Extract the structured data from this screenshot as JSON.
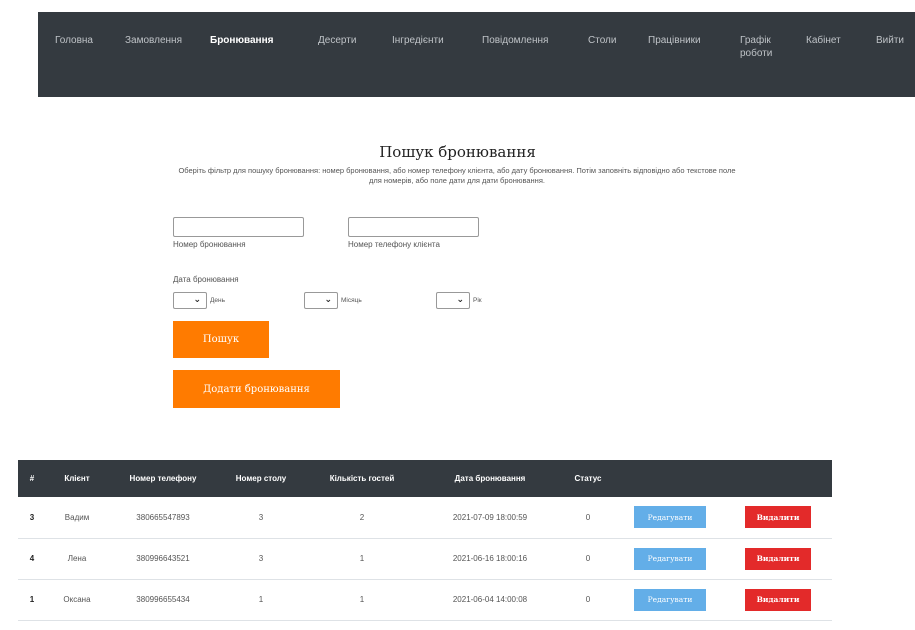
{
  "nav": {
    "items": [
      {
        "label": "Головна"
      },
      {
        "label": "Замовлення"
      },
      {
        "label": "Бронювання"
      },
      {
        "label": "Десерти"
      },
      {
        "label": "Інгредієнти"
      },
      {
        "label": "Повідомлення"
      },
      {
        "label": "Столи"
      },
      {
        "label": "Працівники"
      },
      {
        "label": "Графік роботи"
      },
      {
        "label": "Кабінет"
      },
      {
        "label": "Вийти"
      }
    ],
    "active": "Бронювання"
  },
  "search": {
    "title": "Пошук бронювання",
    "description": "Оберіть фільтр для пошуку бронювання: номер бронювання, або номер телефону клієнта, або дату бронювання. Потім заповніть відповідно або текстове поле для номерів, або поле дати для дати бронювання.",
    "booking_number_label": "Номер бронювання",
    "phone_label": "Номер телефону клієнта",
    "date_label": "Дата бронювання",
    "day_label": "День",
    "month_label": "Місяць",
    "year_label": "Рік",
    "search_button": "Пошук",
    "add_button": "Додати бронювання"
  },
  "table": {
    "headers": [
      "#",
      "Клієнт",
      "Номер телефону",
      "Номер столу",
      "Кількість гостей",
      "Дата бронювання",
      "Статус"
    ],
    "rows": [
      {
        "id": "3",
        "client": "Вадим",
        "phone": "380665547893",
        "table": "3",
        "guests": "2",
        "date": "2021-07-09 18:00:59",
        "status": "0"
      },
      {
        "id": "4",
        "client": "Лена",
        "phone": "380996643521",
        "table": "3",
        "guests": "1",
        "date": "2021-06-16 18:00:16",
        "status": "0"
      },
      {
        "id": "1",
        "client": "Оксана",
        "phone": "380996655434",
        "table": "1",
        "guests": "1",
        "date": "2021-06-04 14:00:08",
        "status": "0"
      }
    ],
    "edit_label": "Редагувати",
    "delete_label": "Видалити"
  },
  "colors": {
    "navbar": "#343a40",
    "accent": "#ff7b00",
    "edit": "#63aee8",
    "delete": "#e32a2a"
  }
}
